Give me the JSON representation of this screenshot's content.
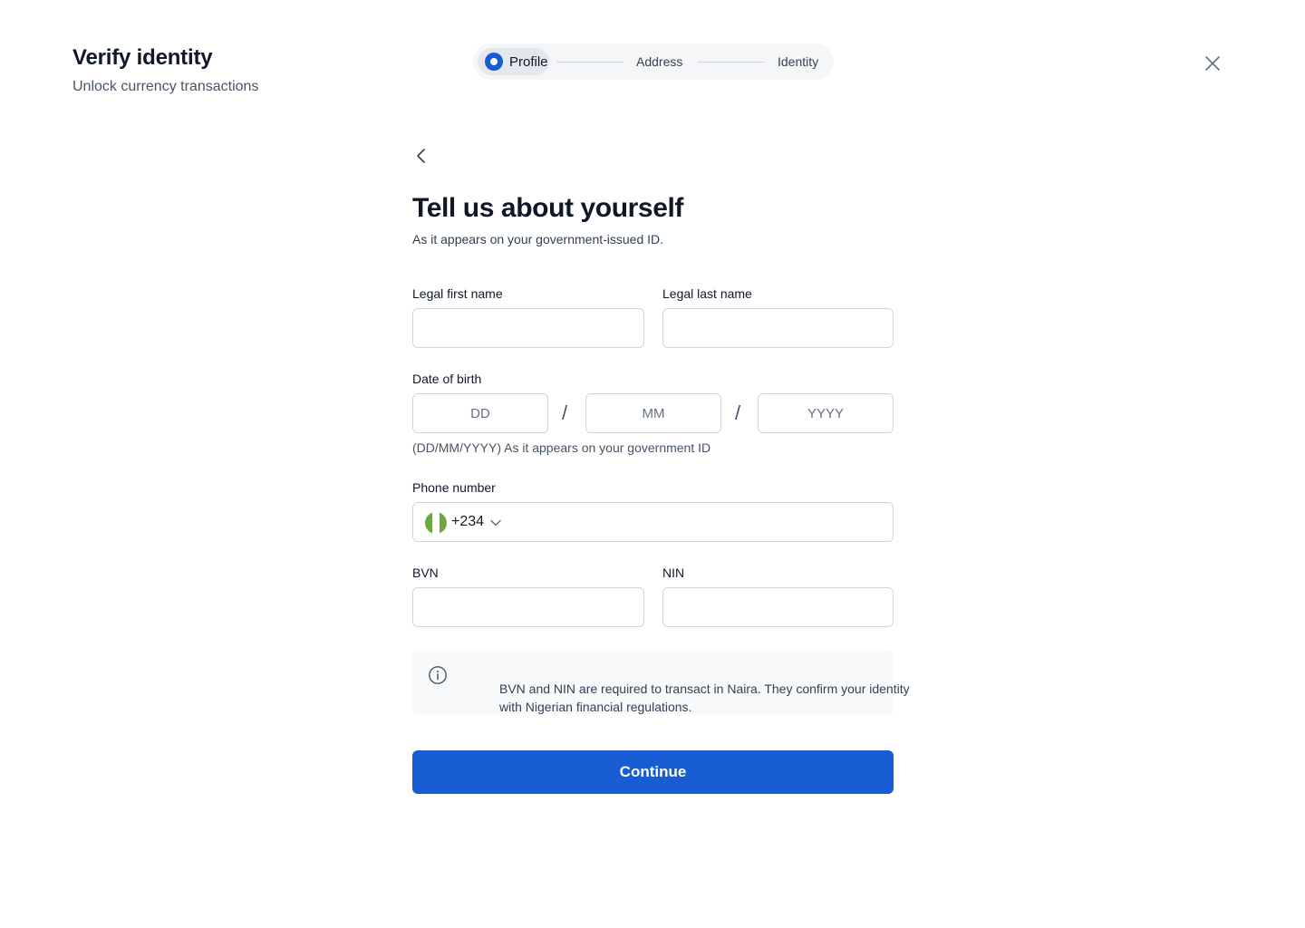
{
  "header": {
    "title": "Verify identity",
    "subtitle": "Unlock currency transactions"
  },
  "stepper": {
    "steps": [
      {
        "label": "Profile",
        "state": "active"
      },
      {
        "label": "Address",
        "state": "upcoming"
      },
      {
        "label": "Identity",
        "state": "upcoming"
      }
    ]
  },
  "form": {
    "title": "Tell us about yourself",
    "subtitle": "As it appears on your government-issued ID.",
    "first_name": {
      "label": "Legal first name",
      "value": "",
      "placeholder": ""
    },
    "last_name": {
      "label": "Legal last name",
      "value": "",
      "placeholder": ""
    },
    "dob": {
      "label": "Date of birth",
      "day_placeholder": "DD",
      "month_placeholder": "MM",
      "year_placeholder": "YYYY",
      "separator": "/",
      "hint": "(DD/MM/YYYY) As it appears on your government ID"
    },
    "phone": {
      "label": "Phone number",
      "country_code": "+234",
      "country_flag": "nigeria-flag",
      "value": ""
    },
    "bvn": {
      "label": "BVN",
      "value": ""
    },
    "nin": {
      "label": "NIN",
      "value": ""
    },
    "info_text": "BVN and NIN are required to transact in Naira. They confirm your identity with Nigerian financial regulations.",
    "continue_label": "Continue"
  },
  "colors": {
    "accent": "#175cd3",
    "flag_green": "#6ca83e",
    "flag_white": "#ffffff"
  }
}
